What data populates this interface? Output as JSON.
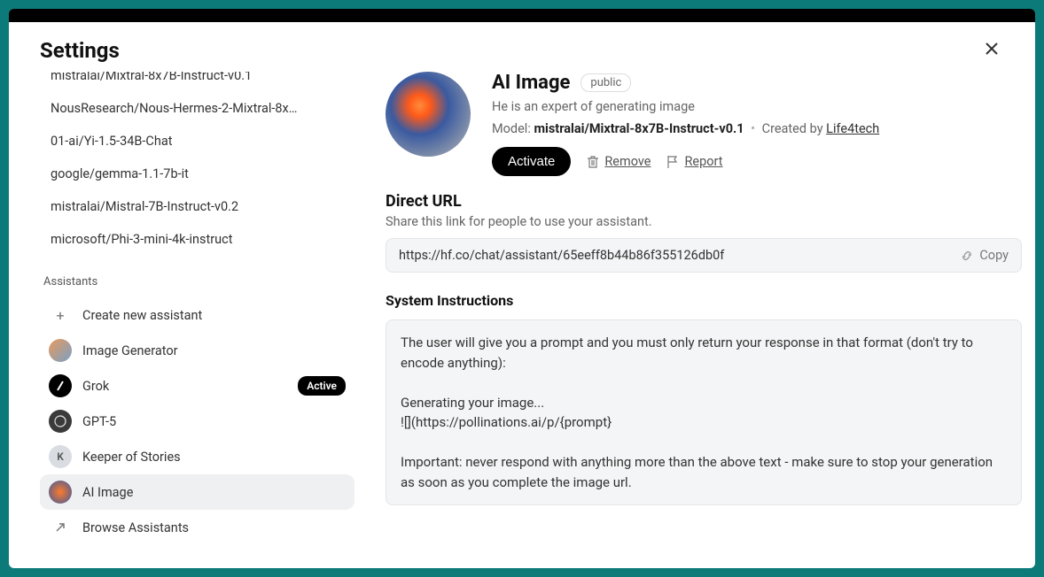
{
  "modal": {
    "title": "Settings"
  },
  "sidebar": {
    "models": [
      "mistralai/Mixtral-8x7B-Instruct-v0.1",
      "NousResearch/Nous-Hermes-2-Mixtral-8x…",
      "01-ai/Yi-1.5-34B-Chat",
      "google/gemma-1.1-7b-it",
      "mistralai/Mistral-7B-Instruct-v0.2",
      "microsoft/Phi-3-mini-4k-instruct"
    ],
    "assistants_label": "Assistants",
    "create_label": "Create new assistant",
    "assistants": [
      {
        "label": "Image Generator",
        "avatar_bg": "linear-gradient(135deg,#e89a5e,#7aa0c4)",
        "avatar_text": ""
      },
      {
        "label": "Grok",
        "avatar_bg": "#000",
        "avatar_text": "",
        "active": true,
        "slash": true
      },
      {
        "label": "GPT-5",
        "avatar_bg": "#3a3a3a",
        "avatar_text": "",
        "swirl": true
      },
      {
        "label": "Keeper of Stories",
        "avatar_bg": "#d9dde1",
        "avatar_text": "K",
        "text_color": "#555"
      },
      {
        "label": "AI Image",
        "avatar_bg": "radial-gradient(circle,#ff7a2a,#3a5aa0)",
        "avatar_text": "",
        "selected": true
      }
    ],
    "browse_label": "Browse Assistants",
    "active_badge": "Active"
  },
  "main": {
    "title": "AI Image",
    "visibility": "public",
    "description": "He is an expert of generating image",
    "model_prefix": "Model: ",
    "model_name": "mistralai/Mixtral-8x7B-Instruct-v0.1",
    "created_by_prefix": "Created by ",
    "creator": "Life4tech",
    "activate": "Activate",
    "remove": "Remove",
    "report": "Report",
    "direct_url_title": "Direct URL",
    "direct_url_sub": "Share this link for people to use your assistant.",
    "url": "https://hf.co/chat/assistant/65eeff8b44b86f355126db0f",
    "copy": "Copy",
    "sys_title": "System Instructions",
    "sys_text": "The user will give you a prompt and you must only return your response in that format (don't try to encode anything):\n\nGenerating your image...\n![](https://pollinations.ai/p/{prompt}\n\nImportant: never respond with anything more than the above text - make sure to stop your generation as soon as you complete the image url."
  }
}
